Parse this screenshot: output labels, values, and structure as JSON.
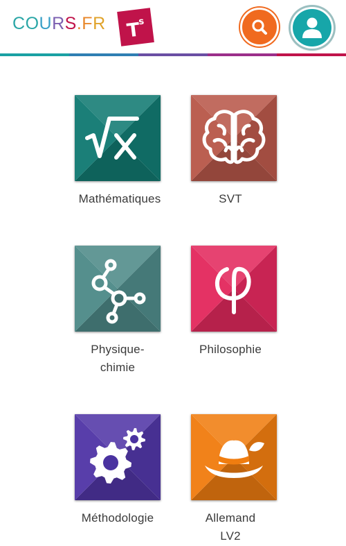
{
  "header": {
    "logo_letters": [
      "C",
      "O",
      "U",
      "R",
      "S",
      ".",
      "F",
      "R"
    ],
    "logo_colors": [
      "#2aa6a6",
      "#2aa6a6",
      "#3aa0c8",
      "#7b5fb0",
      "#c0134a",
      "#e8872a",
      "#e8872a",
      "#e0a32a"
    ],
    "level_badge": "T",
    "level_badge_sup": "s",
    "search_icon": "search-icon",
    "profile_icon": "user-icon"
  },
  "rule_colors": [
    "#1aa1a3",
    "#2f7fb3",
    "#6a4fa3",
    "#9b2f8a",
    "#c0134a"
  ],
  "subjects": [
    {
      "label": "Mathématiques",
      "icon": "sqrt-x-icon",
      "color": "#127a72"
    },
    {
      "label": "SVT",
      "icon": "brain-icon",
      "color": "#b8584a"
    },
    {
      "label": "Physique-\nchimie",
      "icon": "molecule-icon",
      "color": "#4e8a88"
    },
    {
      "label": "Philosophie",
      "icon": "phi-icon",
      "color": "#e3295e"
    },
    {
      "label": "Méthodologie",
      "icon": "gears-icon",
      "color": "#5136a6"
    },
    {
      "label": "Allemand\nLV2",
      "icon": "hat-icon",
      "color": "#f07d10"
    }
  ]
}
